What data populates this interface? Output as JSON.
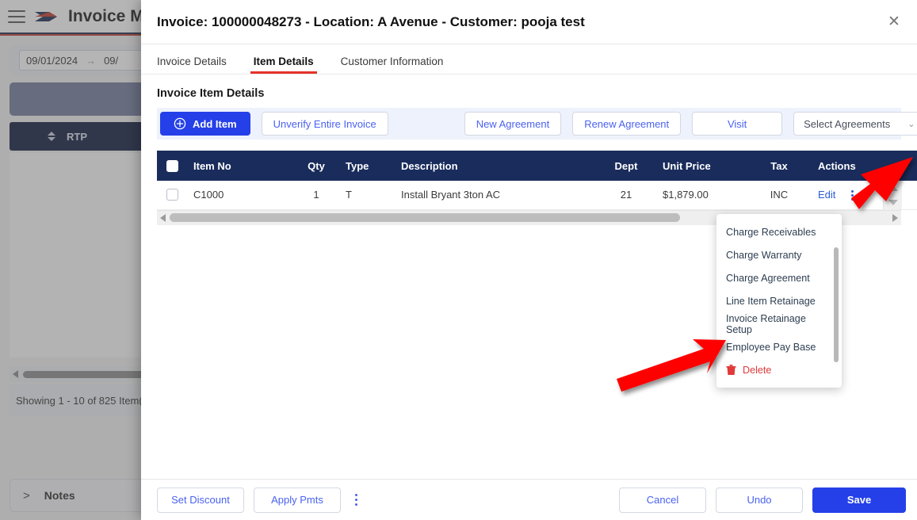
{
  "background": {
    "app_title": "Invoice Mana",
    "date_from": "09/01/2024",
    "date_to": "09/",
    "range_arrow": "→",
    "sort_column_label": "RTP",
    "showing_text": "Showing 1 - 10 of 825 Item(",
    "notes_label": "Notes",
    "notes_chevron": ">"
  },
  "modal": {
    "title": "Invoice: 100000048273 - Location: A Avenue - Customer: pooja test",
    "close_label": "✕",
    "tabs": [
      {
        "label": "Invoice Details",
        "active": false
      },
      {
        "label": "Item Details",
        "active": true
      },
      {
        "label": "Customer Information",
        "active": false
      }
    ],
    "section_title": "Invoice Item Details",
    "toolbar": {
      "add_item": "Add Item",
      "unverify": "Unverify Entire Invoice",
      "new_agreement": "New Agreement",
      "renew_agreement": "Renew Agreement",
      "visit": "Visit",
      "select_agreements": "Select Agreements",
      "select_agreements_caret": "⌄"
    },
    "table": {
      "columns": [
        "Item No",
        "Qty",
        "Type",
        "Description",
        "Dept",
        "Unit Price",
        "Tax",
        "Actions"
      ],
      "rows": [
        {
          "item_no": "C1000",
          "qty": "1",
          "type": "T",
          "description": "Install Bryant 3ton AC",
          "dept": "21",
          "unit_price": "$1,879.00",
          "tax": "INC",
          "action_edit": "Edit"
        }
      ]
    },
    "actions_menu": [
      {
        "label": "Charge Receivables",
        "danger": false
      },
      {
        "label": "Charge Warranty",
        "danger": false
      },
      {
        "label": "Charge Agreement",
        "danger": false
      },
      {
        "label": "Line Item Retainage",
        "danger": false
      },
      {
        "label": "Invoice Retainage Setup",
        "danger": false
      },
      {
        "label": "Employee Pay Base",
        "danger": false
      },
      {
        "label": "Delete",
        "danger": true
      }
    ],
    "footer": {
      "set_discount": "Set Discount",
      "apply_pmts": "Apply Pmts",
      "cancel": "Cancel",
      "undo": "Undo",
      "save": "Save"
    }
  },
  "colors": {
    "primary": "#2540e8",
    "table_header": "#192c5c",
    "tab_underline": "#e4322b",
    "danger": "#e03a3a",
    "annotation_arrow": "#ff0000",
    "link": "#4a62f0"
  }
}
